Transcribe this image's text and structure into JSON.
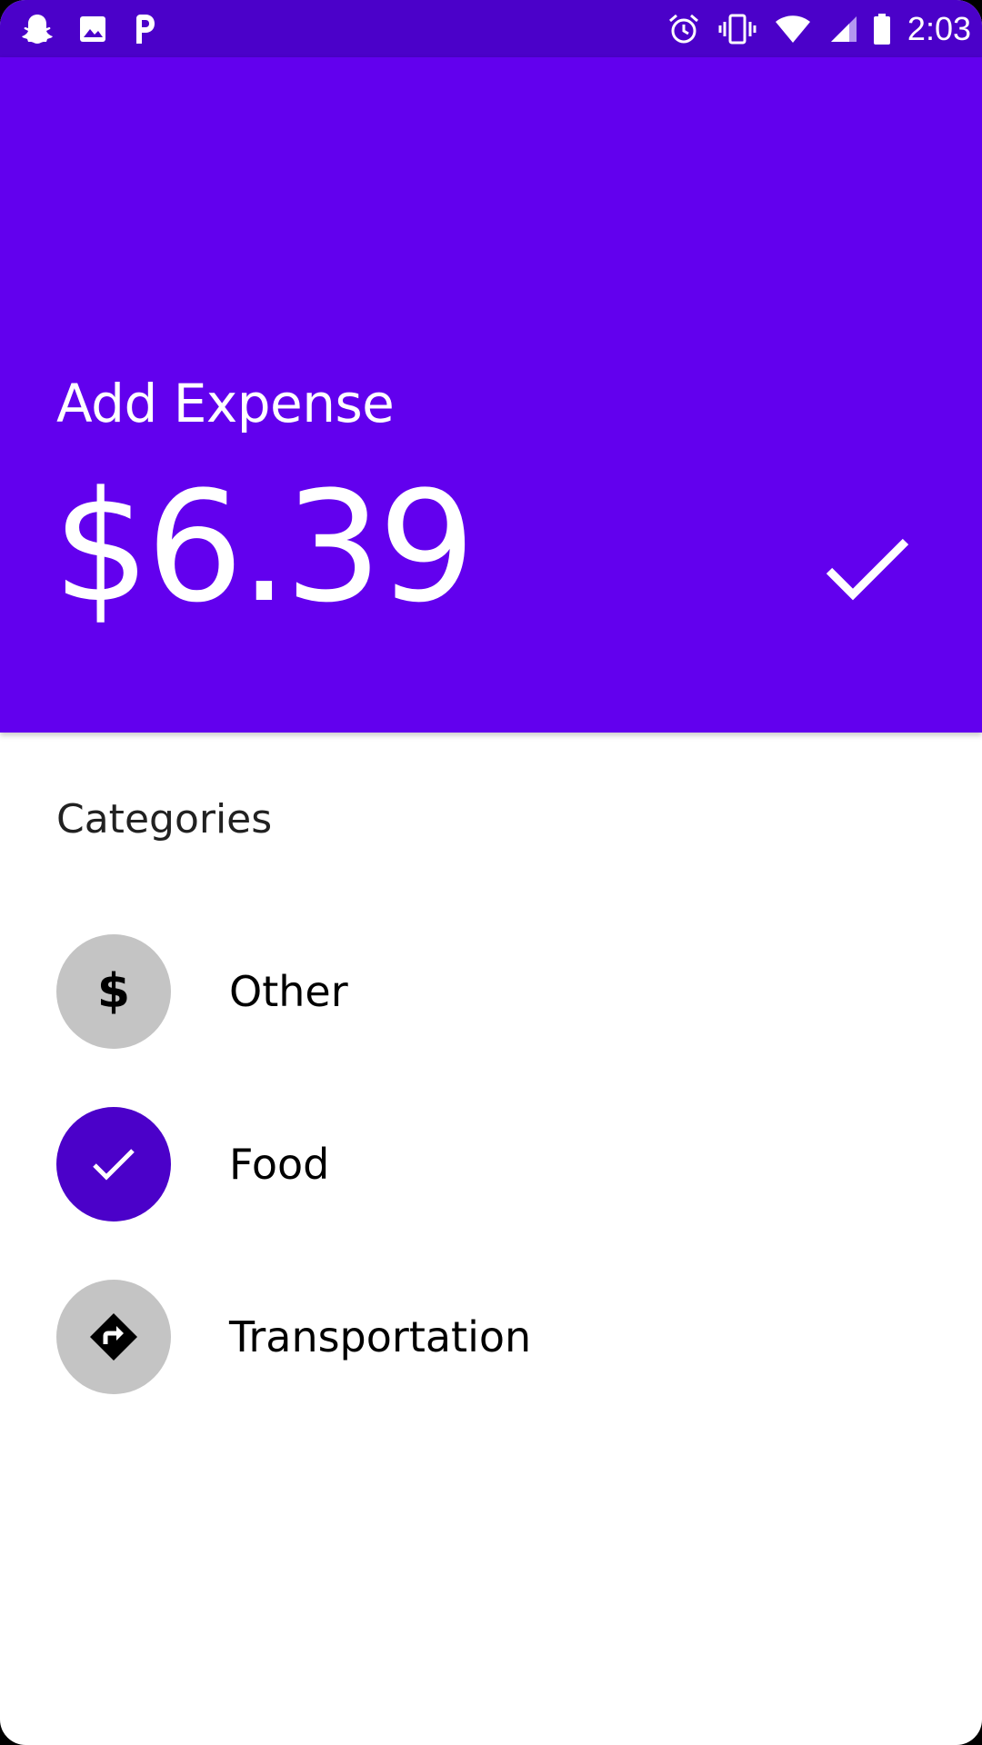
{
  "status_bar": {
    "time": "2:03",
    "left_icons": [
      "snapchat-icon",
      "image-icon",
      "p-app-icon"
    ],
    "right_icons": [
      "alarm-icon",
      "vibrate-icon",
      "wifi-icon",
      "signal-icon",
      "battery-icon"
    ]
  },
  "header": {
    "title": "Add Expense",
    "amount": "$6.39",
    "confirm_icon": "check-icon",
    "background_color": "#6200EE"
  },
  "categories": {
    "title": "Categories",
    "items": [
      {
        "label": "Other",
        "icon": "dollar-icon",
        "selected": false
      },
      {
        "label": "Food",
        "icon": "check-icon",
        "selected": true
      },
      {
        "label": "Transportation",
        "icon": "directions-icon",
        "selected": false
      }
    ]
  },
  "colors": {
    "primary": "#6200EE",
    "primary_dark": "#4B01C9",
    "unselected_circle": "#C4C4C4"
  },
  "dollar_glyph": "$"
}
